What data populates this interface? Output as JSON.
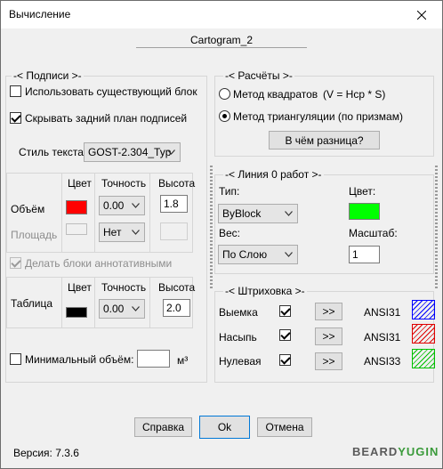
{
  "window": {
    "title": "Вычисление"
  },
  "header": {
    "drawing_name": "Cartogram_2"
  },
  "labels_group": {
    "caption": "-<  Подписи  >-",
    "use_existing_block": {
      "label": "Использовать существующий блок",
      "checked": false
    },
    "hide_background": {
      "label": "Скрывать задний план подписей",
      "checked": true
    },
    "text_style": {
      "label": "Стиль текста",
      "value": "GOST-2.304_Typ"
    },
    "columns": {
      "color": "Цвет",
      "precision": "Точность",
      "height": "Высота"
    },
    "volume": {
      "label": "Объём",
      "color": "#ff0000",
      "precision": "0.00",
      "height": "1.8"
    },
    "area": {
      "label": "Площадь",
      "precision": "Нет",
      "height": ""
    },
    "annotative": {
      "label": "Делать блоки аннотативными",
      "checked": true
    },
    "table": {
      "label": "Таблица",
      "color": "#000000",
      "precision": "0.00",
      "height": "2.0"
    },
    "min_volume": {
      "label": "Минимальный объём:",
      "checked": false,
      "value": "",
      "unit": "м³"
    }
  },
  "calc_group": {
    "caption": "-<  Расчёты  >-",
    "method_squares": {
      "label": "Метод квадратов",
      "formula": "(V = Hcp * S)",
      "selected": false
    },
    "method_triangulation": {
      "label": "Метод триангуляции (по призмам)",
      "selected": true
    },
    "difference_button": "В чём разница?"
  },
  "line_group": {
    "caption": "-<  Линия 0 работ  >-",
    "type_label": "Тип:",
    "type_value": "ByBlock",
    "color_label": "Цвет:",
    "color": "#00ff00",
    "weight_label": "Вес:",
    "weight_value": "По Слою",
    "scale_label": "Масштаб:",
    "scale_value": "1"
  },
  "hatch_group": {
    "caption": "-<  Штриховка  >-",
    "rows": [
      {
        "label": "Выемка",
        "checked": true,
        "button": ">>",
        "pattern": "ANSI31",
        "color": "#0000ff"
      },
      {
        "label": "Насыпь",
        "checked": true,
        "button": ">>",
        "pattern": "ANSI31",
        "color": "#e00000"
      },
      {
        "label": "Нулевая",
        "checked": true,
        "button": ">>",
        "pattern": "ANSI33",
        "color": "#00c000"
      }
    ]
  },
  "footer": {
    "help_button": "Справка",
    "ok_button": "Ok",
    "cancel_button": "Отмена",
    "version": "Версия: 7.3.6",
    "logo": "BEARDYUGIN"
  }
}
